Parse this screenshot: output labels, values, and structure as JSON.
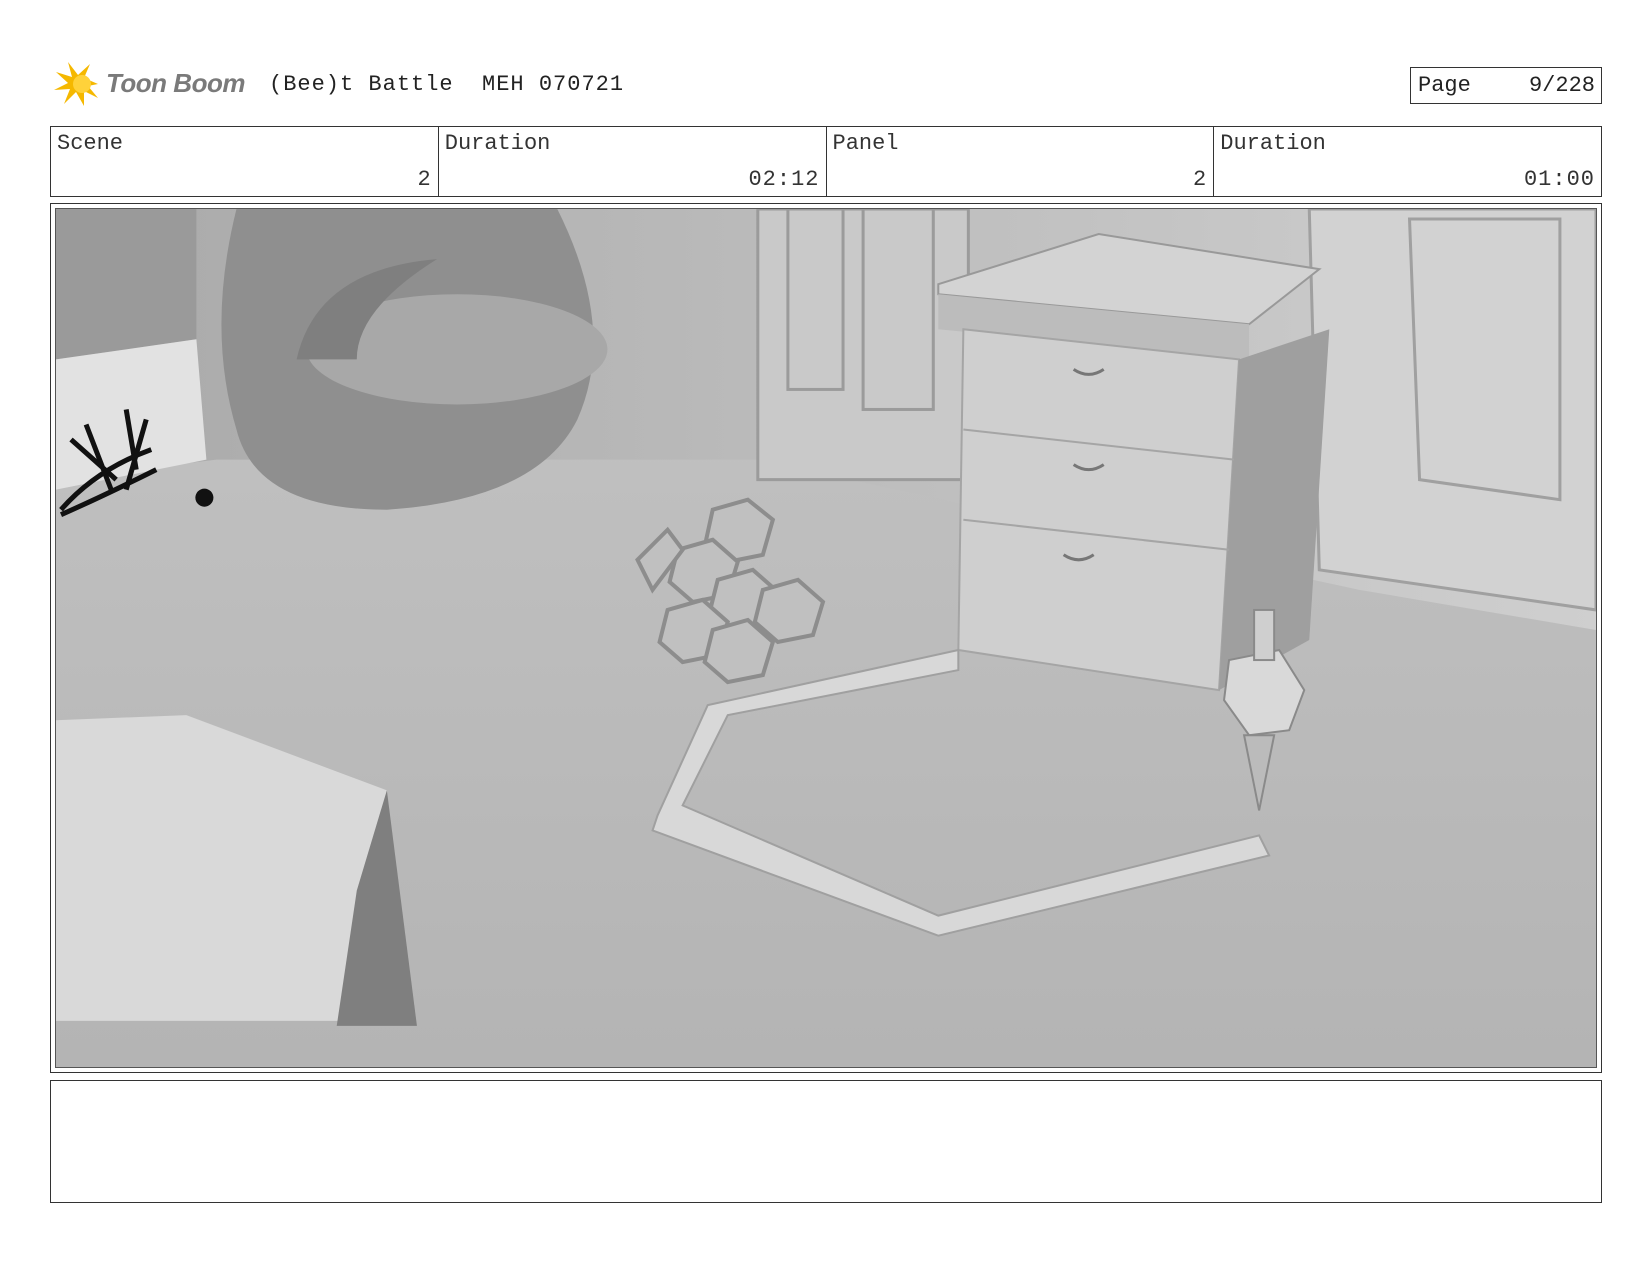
{
  "header": {
    "logo_text": "Toon Boom",
    "title": "(Bee)t Battle  MEH 070721",
    "page_label": "Page",
    "page_value": "9/228"
  },
  "info": [
    {
      "label": "Scene",
      "value": "2"
    },
    {
      "label": "Duration",
      "value": "02:12"
    },
    {
      "label": "Panel",
      "value": "2"
    },
    {
      "label": "Duration",
      "value": "01:00"
    }
  ],
  "colors": {
    "logo_accent": "#f5b800",
    "frame": "#333333",
    "render_base": "#bdbdbd"
  },
  "panel_image": {
    "icons": [
      "toon-boom-logo-icon",
      "storyboard-render-image"
    ]
  },
  "notes": ""
}
